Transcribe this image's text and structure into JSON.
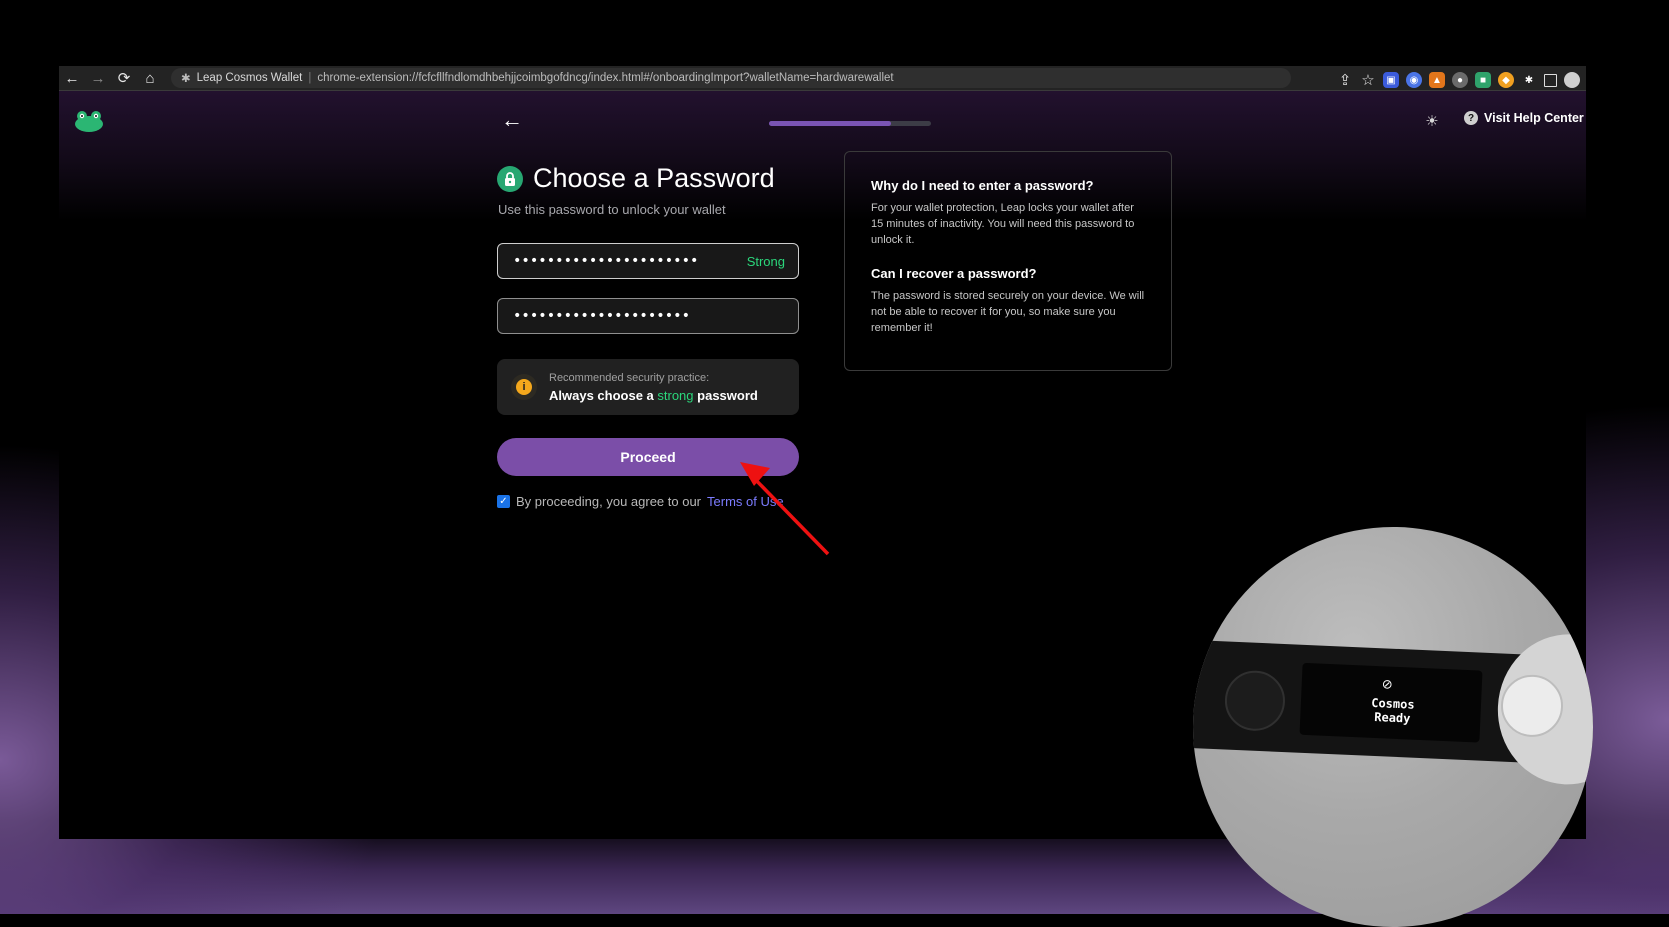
{
  "browser": {
    "back_icon": "arrow-left-icon",
    "tab_title": "Leap Cosmos Wallet",
    "separator": "|",
    "url": "chrome-extension://fcfcfllfndlomdhbehjjcoimbgofdncg/index.html#/onboardingImport?walletName=hardwarewallet"
  },
  "header": {
    "help_label": "Visit Help Center",
    "progress_fraction": 0.75
  },
  "form": {
    "title": "Choose a Password",
    "subtitle": "Use this password to unlock your wallet",
    "password_value": "••••••••••••••••••••••",
    "strength_label": "Strong",
    "confirm_value": "•••••••••••••••••••••",
    "tip_small": "Recommended security practice:",
    "tip_part1": "Always choose a ",
    "tip_highlight": "strong",
    "tip_part2": " password",
    "proceed_label": "Proceed",
    "agree_text": "By proceeding, you agree to our ",
    "terms_label": "Terms of Use"
  },
  "faq": {
    "q1": "Why do I need to enter a password?",
    "a1": "For your wallet protection, Leap locks your wallet after 15 minutes of inactivity. You will need this password to unlock it.",
    "q2": "Can I recover a password?",
    "a2": "The password is stored securely on your device. We will not be able to recover it for you, so make sure you remember it!"
  },
  "device": {
    "line1": "Cosmos",
    "line2": "Ready"
  },
  "colors": {
    "accent": "#7b4ea8",
    "strong_green": "#2bd67b",
    "terms_link": "#7c7cff"
  }
}
